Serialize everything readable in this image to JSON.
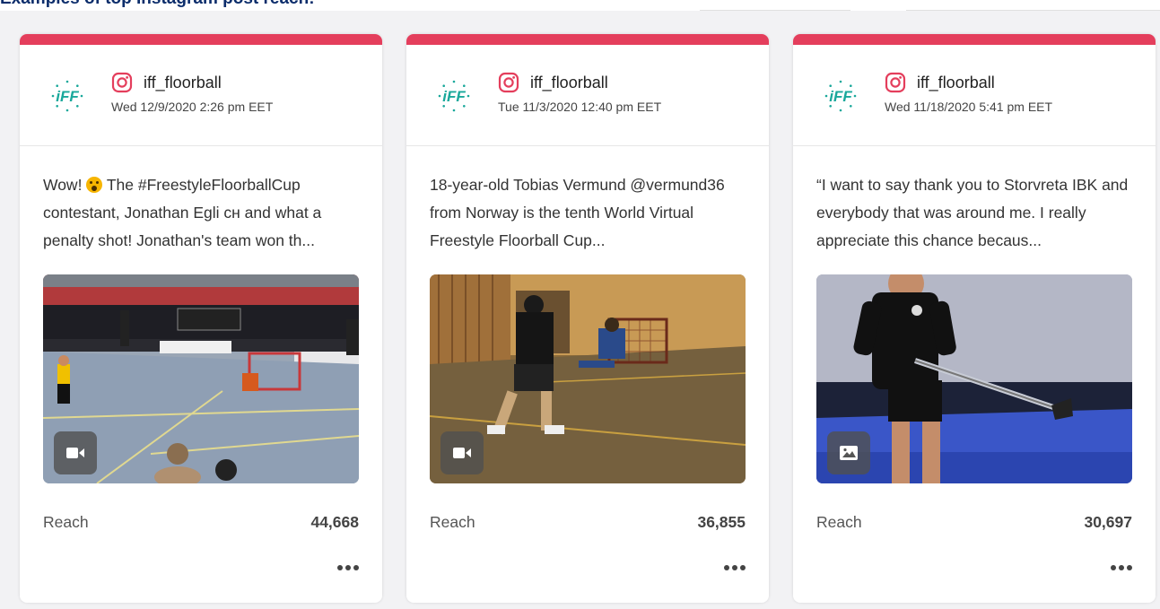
{
  "page": {
    "heading": "Examples of top Instagram post reach:"
  },
  "colors": {
    "accent_bar": "#e43e5c",
    "instagram_icon": "#e43e5c",
    "iff_logo": "#1aa89b"
  },
  "posts": [
    {
      "avatar_icon": "iff-logo-icon",
      "account": "iff_floorball",
      "timestamp": "Wed 12/9/2020 2:26 pm EET",
      "caption_before_emoji": "Wow! ",
      "emoji": "astonished-face-emoji",
      "caption_after_emoji": " The #FreestyleFloorballCup contestant, Jonathan Egli сн and what a penalty shot! Jonathan's team won th...",
      "media_type": "video",
      "media_type_icon": "video-camera-icon",
      "stat_label": "Reach",
      "stat_value": "44,668",
      "more_icon": "more-dots-icon"
    },
    {
      "avatar_icon": "iff-logo-icon",
      "account": "iff_floorball",
      "timestamp": "Tue 11/3/2020 12:40 pm EET",
      "caption": "18-year-old Tobias Vermund @vermund36 from Norway is the tenth World Virtual Freestyle Floorball Cup...",
      "media_type": "video",
      "media_type_icon": "video-camera-icon",
      "stat_label": "Reach",
      "stat_value": "36,855",
      "more_icon": "more-dots-icon"
    },
    {
      "avatar_icon": "iff-logo-icon",
      "account": "iff_floorball",
      "timestamp": "Wed 11/18/2020 5:41 pm EET",
      "caption": "“I want to say thank you to Storvreta IBK and everybody that was around me. I really appreciate this chance becaus...",
      "media_type": "image",
      "media_type_icon": "image-icon",
      "stat_label": "Reach",
      "stat_value": "30,697",
      "more_icon": "more-dots-icon"
    }
  ]
}
